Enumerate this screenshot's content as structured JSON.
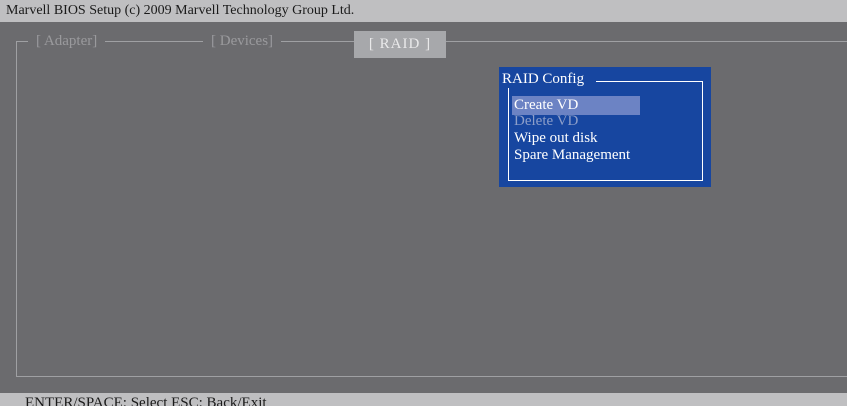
{
  "title_bar": {
    "text": "Marvell BIOS Setup (c) 2009 Marvell Technology Group Ltd."
  },
  "tabs": [
    {
      "label": "[ Adapter]",
      "active": false
    },
    {
      "label": "[ Devices]",
      "active": false
    },
    {
      "label": "[  RAID  ]",
      "active": true
    }
  ],
  "popup": {
    "title": "RAID Config",
    "items": [
      {
        "label": "Create VD",
        "state": "selected"
      },
      {
        "label": "Delete VD",
        "state": "disabled"
      },
      {
        "label": "Wipe out disk",
        "state": "normal"
      },
      {
        "label": "Spare Management",
        "state": "normal"
      }
    ]
  },
  "status_bar": {
    "text": "ENTER/SPACE: Select  ESC: Back/Exit"
  },
  "colors": {
    "background": "#6b6b6e",
    "bar": "#bfbfc1",
    "popup": "#1746a0",
    "selection": "#6c83c4",
    "active_tab": "#a7a8ab"
  }
}
